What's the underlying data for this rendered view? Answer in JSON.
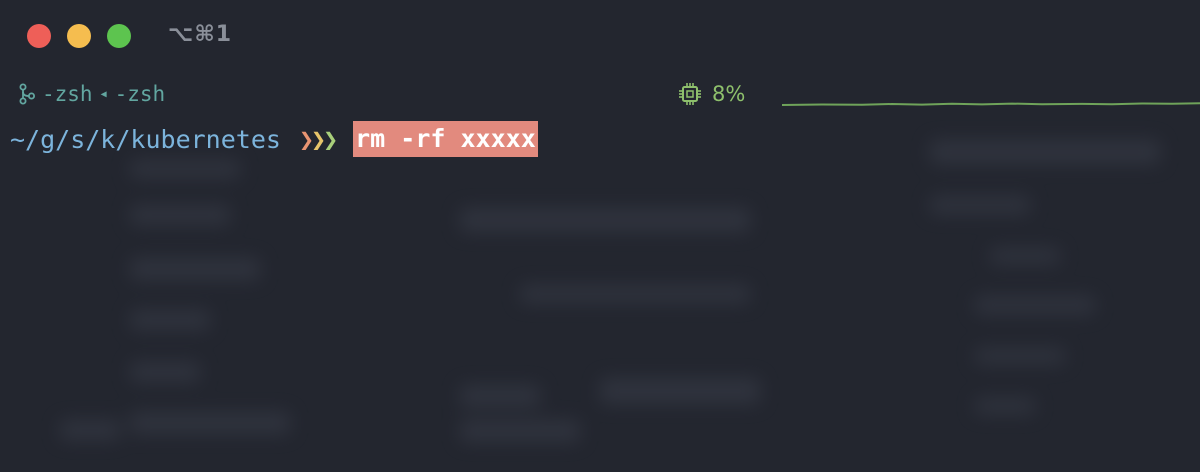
{
  "window": {
    "tab_title": "⌥⌘1"
  },
  "statusbar": {
    "session_left": "-zsh",
    "session_right": "-zsh",
    "cpu_percent_label": "8%",
    "cpu_usage_percent": 8,
    "accent_color": "#8ec06c",
    "branch_color": "#62a6a0"
  },
  "prompt": {
    "cwd": "~/g/s/k/kubernetes",
    "arrows": [
      "❯",
      "❯",
      "❯"
    ],
    "command": "rm -rf xxxxx",
    "command_highlight_color": "#e28a7e"
  }
}
